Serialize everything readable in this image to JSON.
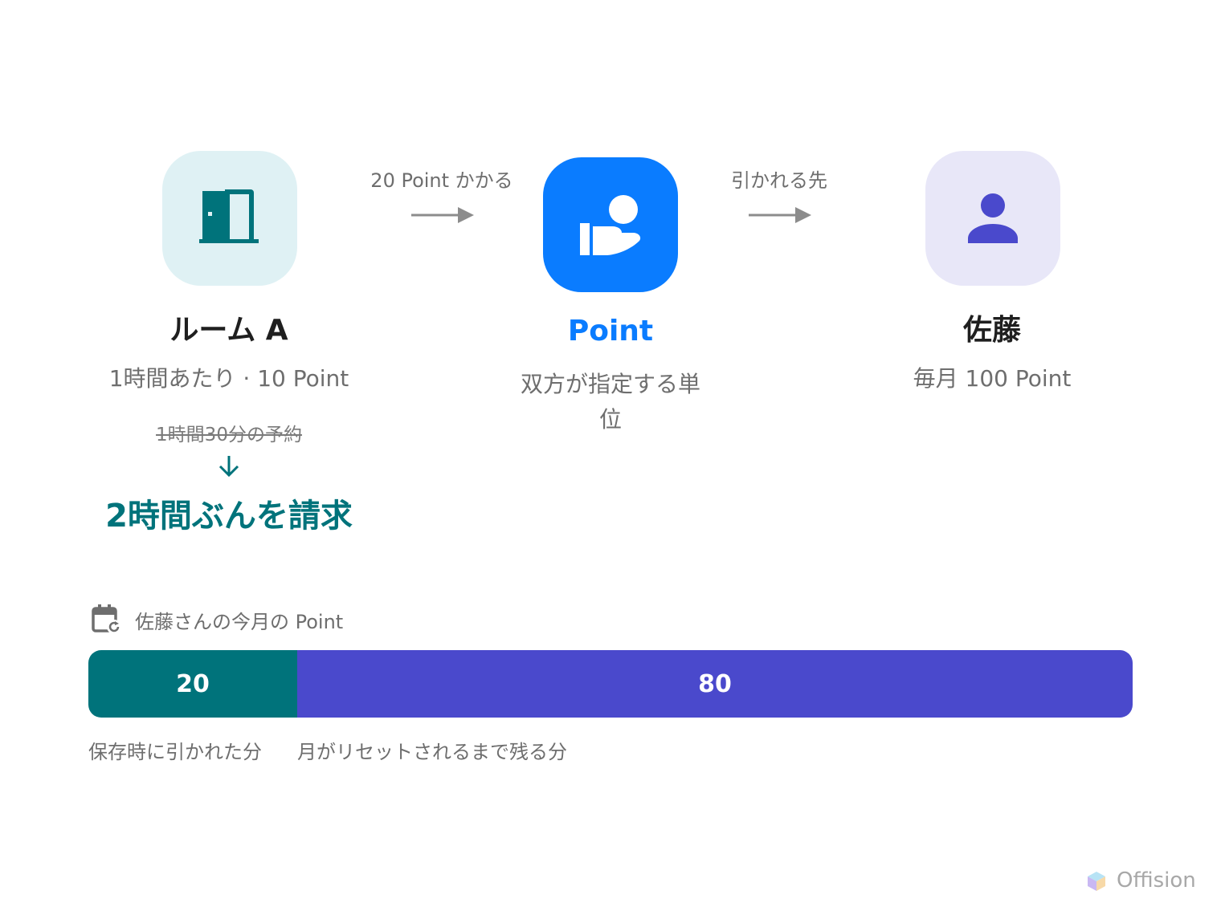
{
  "room": {
    "name": "ルーム A",
    "rate": "1時間あたり · 10 Point",
    "reservation_struck": "1時間30分の予約",
    "billed": "2時間ぶんを請求"
  },
  "arrow1": {
    "label": "20 Point かかる"
  },
  "point": {
    "name": "Point",
    "description_line1": "双方が指定する単",
    "description_line2": "位"
  },
  "arrow2": {
    "label": "引かれる先"
  },
  "user": {
    "name": "佐藤",
    "allowance": "毎月 100 Point"
  },
  "usage": {
    "title": "佐藤さんの今月の Point",
    "total": 100,
    "used": {
      "value": "20",
      "fraction": 0.2,
      "legend": "保存時に引かれた分"
    },
    "remaining": {
      "value": "80",
      "fraction": 0.8,
      "legend": "月がリセットされるまで残る分"
    }
  },
  "brand": {
    "name": "Offision"
  },
  "colors": {
    "teal": "#00737b",
    "blue": "#0a7cff",
    "indigo": "#4a49cc",
    "teal_tile_bg": "#dff1f4",
    "indigo_tile_bg": "#e8e7f8",
    "arrow_gray": "#8c8c8c"
  },
  "icons": [
    "door-icon",
    "hand-coin-icon",
    "person-icon",
    "calendar-refresh-icon",
    "arrow-down-icon",
    "offision-logo-icon"
  ]
}
